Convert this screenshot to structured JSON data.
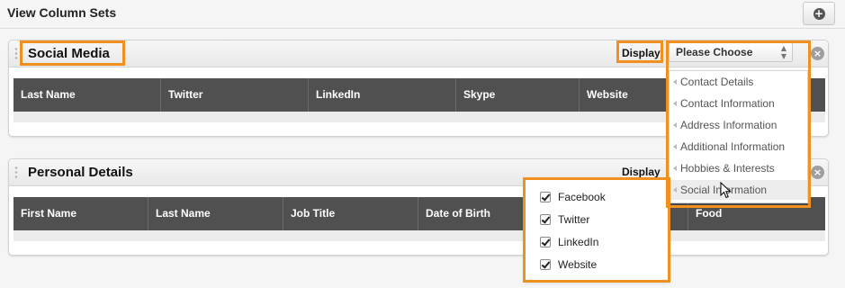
{
  "page": {
    "title": "View Column Sets"
  },
  "panels": [
    {
      "title": "Social Media",
      "display_label": "Display",
      "columns": [
        "Last Name",
        "Twitter",
        "LinkedIn",
        "Skype",
        "Website",
        ""
      ]
    },
    {
      "title": "Personal Details",
      "display_label": "Display",
      "columns": [
        "First Name",
        "Last Name",
        "Job Title",
        "Date of Birth",
        "",
        "Food"
      ]
    }
  ],
  "select": {
    "value": "Please Choose",
    "options": [
      "Contact Details",
      "Contact Information",
      "Address Information",
      "Additional Information",
      "Hobbies & Interests",
      "Social Information"
    ],
    "hovered_option": "Social Information"
  },
  "checkbox_popup": {
    "items": [
      {
        "label": "Facebook",
        "checked": true
      },
      {
        "label": "Twitter",
        "checked": true
      },
      {
        "label": "LinkedIn",
        "checked": true
      },
      {
        "label": "Website",
        "checked": true
      }
    ]
  },
  "icons": {
    "add": "plus-circle-icon",
    "close": "close-circle-icon",
    "drag": "drag-handle-icon"
  },
  "colors": {
    "highlight": "#f0901e",
    "header_row": "#505050"
  }
}
